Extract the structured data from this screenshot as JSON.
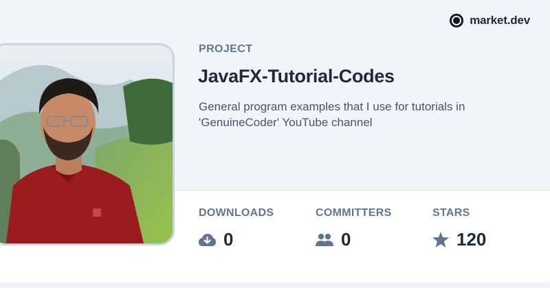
{
  "brand": {
    "name": "market.dev"
  },
  "project": {
    "kicker": "PROJECT",
    "title": "JavaFX-Tutorial-Codes",
    "description": "General program examples that I use for tutorials in 'GenuineCoder' YouTube channel"
  },
  "stats": [
    {
      "label": "DOWNLOADS",
      "value": "0",
      "icon": "cloud-download-icon"
    },
    {
      "label": "COMMITTERS",
      "value": "0",
      "icon": "users-icon"
    },
    {
      "label": "STARS",
      "value": "120",
      "icon": "star-icon"
    }
  ],
  "colors": {
    "background": "#f1f5f9",
    "text_primary": "#1e293b",
    "text_muted": "#64748b",
    "icon": "#64748b"
  }
}
